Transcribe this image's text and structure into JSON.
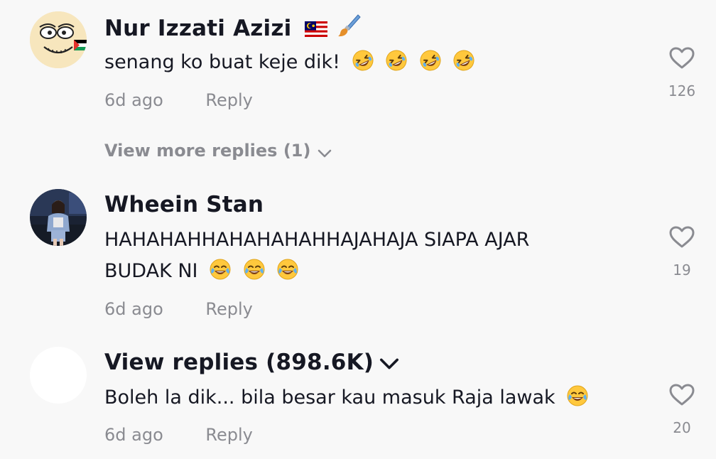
{
  "comments": [
    {
      "username": "Nur Izzati Azizi",
      "username_icons": [
        "malaysia-flag-icon",
        "paintbrush-icon"
      ],
      "text": "senang ko buat keje dik!",
      "text_emojis": [
        "rofl-emoji",
        "rofl-emoji",
        "rofl-emoji",
        "rofl-emoji"
      ],
      "time": "6d ago",
      "reply_label": "Reply",
      "likes": "126",
      "view_more_label": "View more replies (1)"
    },
    {
      "username": "Wheein Stan",
      "text_line1": "HAHAHAHHAHAHAHAHHAJAHAJA SIAPA AJAR",
      "text_line2": "BUDAK NI",
      "text_emojis": [
        "joy-emoji",
        "joy-emoji",
        "joy-emoji"
      ],
      "time": "6d ago",
      "reply_label": "Reply",
      "likes": "19"
    },
    {
      "username": "View replies (898.6K)",
      "text": "Boleh la dik... bila besar kau masuk Raja lawak",
      "text_emojis": [
        "joy-emoji"
      ],
      "time": "6d ago",
      "reply_label": "Reply",
      "likes": "20"
    }
  ],
  "colors": {
    "background": "#f8f8f8",
    "primary_text": "#161823",
    "secondary_text": "#8a8b91",
    "emoji_yellow": "#ffc83d"
  }
}
